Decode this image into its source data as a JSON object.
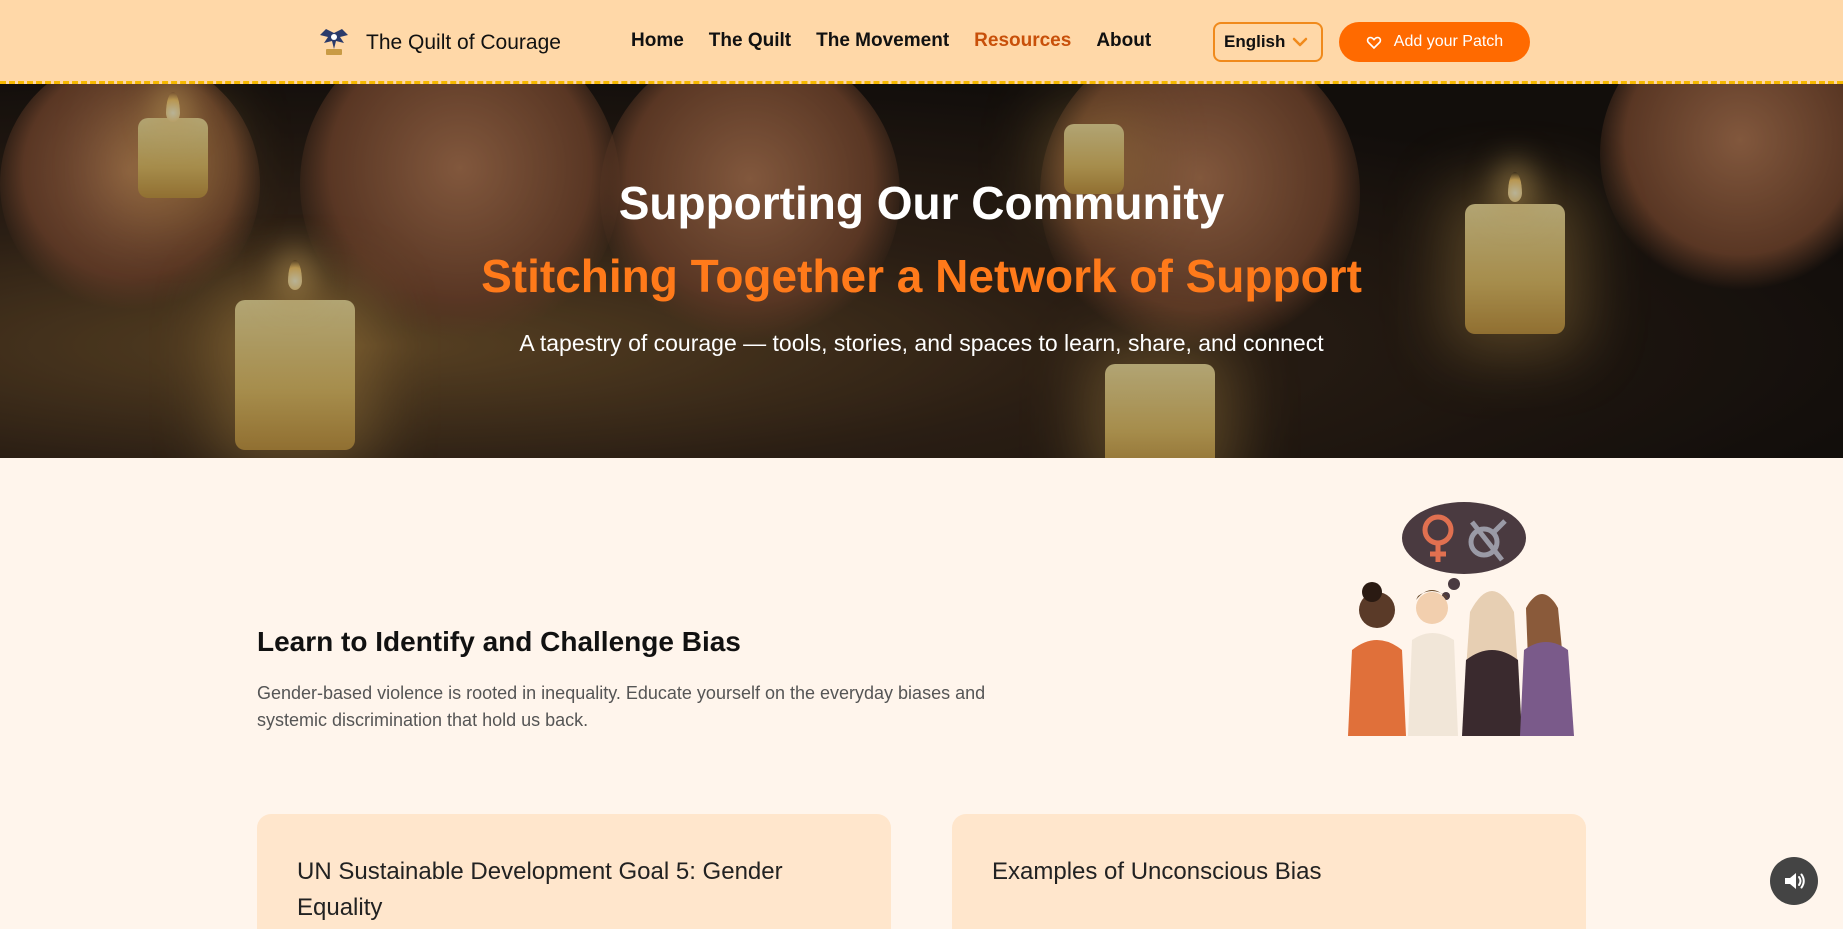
{
  "brand": {
    "name": "The Quilt of Courage"
  },
  "nav": {
    "items": [
      {
        "label": "Home",
        "active": false
      },
      {
        "label": "The Quilt",
        "active": false
      },
      {
        "label": "The Movement",
        "active": false
      },
      {
        "label": "Resources",
        "active": true
      },
      {
        "label": "About",
        "active": false
      }
    ],
    "language": "English",
    "cta_label": "Add your Patch"
  },
  "hero": {
    "title": "Supporting Our Community",
    "subtitle": "Stitching Together a Network of Support",
    "tagline": "A tapestry of courage — tools, stories, and spaces to learn, share, and connect"
  },
  "section": {
    "title": "Learn to Identify and Challenge Bias",
    "description": "Gender-based violence is rooted in inequality. Educate yourself on the everyday biases and systemic discrimination that hold us back."
  },
  "cards": [
    {
      "title": "UN Sustainable Development Goal 5: Gender Equality"
    },
    {
      "title": "Examples of Unconscious Bias"
    }
  ],
  "colors": {
    "accent": "#ff6a00",
    "nav_bg": "#ffd8a8",
    "page_bg": "#fff5ec",
    "active_link": "#c8500a"
  },
  "icons": {
    "cta": "heart-icon",
    "language": "chevron-down-icon",
    "audio": "speaker-icon"
  }
}
